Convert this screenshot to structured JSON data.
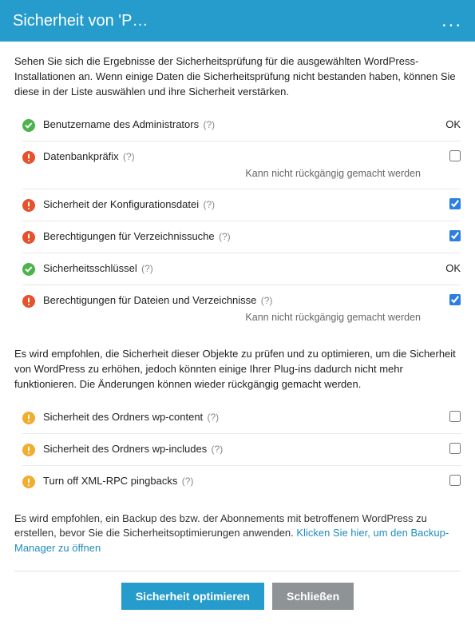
{
  "header": {
    "title": "Sicherheit von 'P…",
    "more": "..."
  },
  "intro": "Sehen Sie sich die Ergebnisse der Sicherheitsprüfung für die ausgewählten WordPress-Installationen an. Wenn einige Daten die Sicherheitsprüfung nicht bestanden haben, können Sie diese in der Liste auswählen und ihre Sicherheit verstärken.",
  "help_marker": "(?)",
  "critical_items": [
    {
      "icon": "ok",
      "label": "Benutzername des Administrators",
      "status_text": "OK",
      "checkbox": null,
      "checked": null,
      "note": null
    },
    {
      "icon": "alert",
      "label": "Datenbankpräfix",
      "status_text": null,
      "checkbox": true,
      "checked": false,
      "note": "Kann nicht rückgängig gemacht werden"
    },
    {
      "icon": "alert",
      "label": "Sicherheit der Konfigurationsdatei",
      "status_text": null,
      "checkbox": true,
      "checked": true,
      "note": null
    },
    {
      "icon": "alert",
      "label": "Berechtigungen für Verzeichnissuche",
      "status_text": null,
      "checkbox": true,
      "checked": true,
      "note": null
    },
    {
      "icon": "ok",
      "label": "Sicherheitsschlüssel",
      "status_text": "OK",
      "checkbox": null,
      "checked": null,
      "note": null
    },
    {
      "icon": "alert",
      "label": "Berechtigungen für Dateien und Verzeichnisse",
      "status_text": null,
      "checkbox": true,
      "checked": true,
      "note": "Kann nicht rückgängig gemacht werden"
    }
  ],
  "section2_text": "Es wird empfohlen, die Sicherheit dieser Objekte zu prüfen und zu optimieren, um die Sicherheit von WordPress zu erhöhen, jedoch könnten einige Ihrer Plug-ins dadurch nicht mehr funktionieren. Die Änderungen können wieder rückgängig gemacht werden.",
  "recommended_items": [
    {
      "icon": "warn",
      "label": "Sicherheit des Ordners wp-content",
      "checkbox": true,
      "checked": false
    },
    {
      "icon": "warn",
      "label": "Sicherheit des Ordners wp-includes",
      "checkbox": true,
      "checked": false
    },
    {
      "icon": "warn",
      "label": "Turn off XML-RPC pingbacks",
      "checkbox": true,
      "checked": false
    }
  ],
  "backup_text": "Es wird empfohlen, ein Backup des bzw. der Abonnements mit betroffenem WordPress zu erstellen, bevor Sie die Sicherheitsoptimierungen anwenden. ",
  "backup_link": "Klicken Sie hier, um den Backup-Manager zu öffnen",
  "buttons": {
    "optimize": "Sicherheit optimieren",
    "close": "Schließen"
  },
  "icons": {
    "ok_color": "#4db34d",
    "alert_color": "#e6522c",
    "warn_color": "#f0ad2e"
  }
}
